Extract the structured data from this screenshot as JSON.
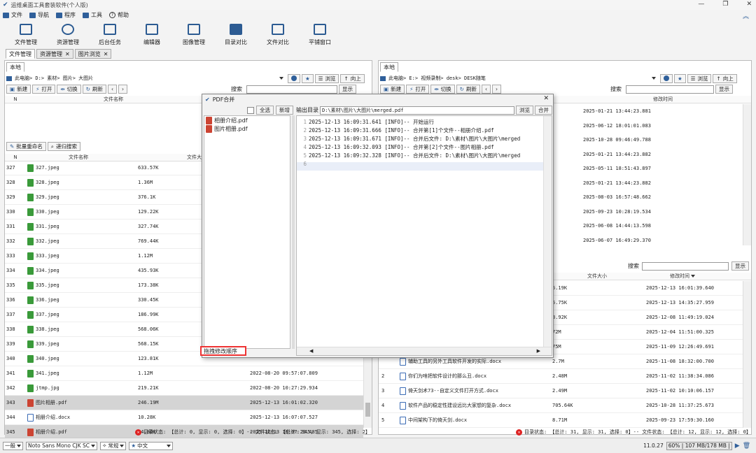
{
  "app": {
    "title": "运维桌面工具套装软件(个人版)"
  },
  "menu": [
    "文件",
    "导航",
    "程序",
    "工具",
    "帮助"
  ],
  "toolbar": [
    "文件管理",
    "资源管理",
    "后台任务",
    "编辑器",
    "图像管理",
    "目录对比",
    "文件对比",
    "平铺窗口"
  ],
  "tabs": [
    "文件管理",
    "资源管理",
    "图片浏览"
  ],
  "left": {
    "local_tab": "本地",
    "path": "此电脑> D:> 素材> 图片> 大图片",
    "browse": "浏览",
    "up": "向上",
    "search_label": "搜索",
    "show": "显示",
    "buttons": [
      "新建",
      "打开",
      "切换",
      "刷新"
    ],
    "col_n": "N",
    "col_name": "文件名称",
    "batch_rename": "批量重命名",
    "recursive_search": "递归搜索",
    "col_n2": "N",
    "col_name2": "文件名称",
    "col_size2": "文件大",
    "rows": [
      {
        "n": "327",
        "name": "327.jpeg",
        "size": "633.57K",
        "time": "",
        "type": "img"
      },
      {
        "n": "328",
        "name": "328.jpeg",
        "size": "1.36M",
        "time": "",
        "type": "img"
      },
      {
        "n": "329",
        "name": "329.jpeg",
        "size": "376.1K",
        "time": "",
        "type": "img"
      },
      {
        "n": "330",
        "name": "330.jpeg",
        "size": "129.22K",
        "time": "",
        "type": "img"
      },
      {
        "n": "331",
        "name": "331.jpeg",
        "size": "327.74K",
        "time": "",
        "type": "img"
      },
      {
        "n": "332",
        "name": "332.jpeg",
        "size": "769.44K",
        "time": "",
        "type": "img"
      },
      {
        "n": "333",
        "name": "333.jpeg",
        "size": "1.12M",
        "time": "",
        "type": "img"
      },
      {
        "n": "334",
        "name": "334.jpeg",
        "size": "435.93K",
        "time": "",
        "type": "img"
      },
      {
        "n": "335",
        "name": "335.jpeg",
        "size": "173.38K",
        "time": "",
        "type": "img"
      },
      {
        "n": "336",
        "name": "336.jpeg",
        "size": "330.45K",
        "time": "",
        "type": "img"
      },
      {
        "n": "337",
        "name": "337.jpeg",
        "size": "186.99K",
        "time": "",
        "type": "img"
      },
      {
        "n": "338",
        "name": "338.jpeg",
        "size": "568.06K",
        "time": "",
        "type": "img"
      },
      {
        "n": "339",
        "name": "339.jpeg",
        "size": "568.15K",
        "time": "",
        "type": "img"
      },
      {
        "n": "340",
        "name": "340.jpeg",
        "size": "123.81K",
        "time": "",
        "type": "img"
      },
      {
        "n": "341",
        "name": "341.jpeg",
        "size": "1.12M",
        "time": "2022-08-20 09:57:07.809",
        "type": "img"
      },
      {
        "n": "342",
        "name": "jtmp.jpg",
        "size": "219.21K",
        "time": "2022-08-20 10:27:29.934",
        "type": "img"
      },
      {
        "n": "343",
        "name": "图片相册.pdf",
        "size": "246.19M",
        "time": "2025-12-13 16:01:02.320",
        "type": "pdf"
      },
      {
        "n": "344",
        "name": "相册介绍.docx",
        "size": "10.28K",
        "time": "2025-12-13 16:07:07.527",
        "type": "doc"
      },
      {
        "n": "345",
        "name": "相册介绍.pdf",
        "size": "84.86K",
        "time": "2025-12-13 16:07:23.485",
        "type": "pdf"
      }
    ],
    "status": "目录状态: 【总计: 0, 显示: 0, 选择: 0】-- 文件状态: 【总计: 345, 显示: 345, 选择: 2】"
  },
  "right": {
    "local_tab": "本地",
    "path": "此电脑> E:> 视频录制> desk> DESK随笔",
    "browse": "浏览",
    "up": "向上",
    "search_label": "搜索",
    "show": "显示",
    "buttons": [
      "新建",
      "打开",
      "切换",
      "刷新"
    ],
    "col_mtime": "修改时间",
    "top_times": [
      "2025-01-21 13:44:23.881",
      "2025-06-12 18:01:01.083",
      "2025-10-28 09:46:49.788",
      "2025-01-21 13:44:23.882",
      "2025-05-11 18:51:43.897",
      "2025-01-21 13:44:23.882",
      "2025-08-03 16:57:48.662",
      "2025-09-23 10:28:19.534",
      "2025-06-08 14:44:13.598",
      "2025-06-07 16:49:29.370"
    ],
    "search_label2": "搜索",
    "show2": "显示",
    "col_size": "文件大小",
    "col_mtime2": "修改时间",
    "bottom_rows": [
      {
        "n": "",
        "name": "",
        "size": "5.19K",
        "time": "2025-12-13 16:01:39.640"
      },
      {
        "n": "",
        "name": "",
        "size": "5.75K",
        "time": "2025-12-13 14:35:27.959"
      },
      {
        "n": "",
        "name": "",
        "size": "3.92K",
        "time": "2025-12-08 11:49:19.024"
      },
      {
        "n": "",
        "name": "",
        "size": "72M",
        "time": "2025-12-04 11:51:00.325"
      },
      {
        "n": "",
        "name": "",
        "size": "75M",
        "time": "2025-11-09 12:26:49.691"
      },
      {
        "n": "",
        "name": "辅助工具的另外工具软件开发的实际.docx",
        "size": "2.7M",
        "time": "2025-11-08 18:32:00.700"
      },
      {
        "n": "2",
        "name": "你们为啥把软件设计的那么丑.docx",
        "size": "2.48M",
        "time": "2025-11-02 11:38:34.086"
      },
      {
        "n": "3",
        "name": "倚天剑术73--自定义文件打开方式.docx",
        "size": "2.49M",
        "time": "2025-11-02 10:10:06.157"
      },
      {
        "n": "4",
        "name": "软件产品的稳定性建设远比大家想的复杂.docx",
        "size": "705.64K",
        "time": "2025-10-28 11:37:25.673"
      },
      {
        "n": "5",
        "name": "中间架构下的倚天剑.docx",
        "size": "8.71M",
        "time": "2025-09-23 17:59:30.160"
      }
    ],
    "status": "目录状态: 【总计: 31, 显示: 31, 选择: 0】-- 文件状态: 【总计: 12, 显示: 12, 选择: 0】"
  },
  "dialog": {
    "title": "PDF合并",
    "select_all": "全选",
    "new": "新增",
    "files": [
      "相册介绍.pdf",
      "图片相册.pdf"
    ],
    "output_label": "输出目录",
    "output_path": "D:\\素材\\图片\\大图片\\merged.pdf",
    "browse": "浏览",
    "merge": "合并",
    "drag_hint": "拖拽修改顺序",
    "log": [
      "2025-12-13 16:09:31.641 [INFO]-- 开始运行",
      "2025-12-13 16:09:31.666 [INFO]-- 合并第[1]个文件--相册介绍.pdf",
      "2025-12-13 16:09:31.671 [INFO]-- 合并后文件: D:\\素材\\图片\\大图片\\merged",
      "2025-12-13 16:09:32.093 [INFO]-- 合并第[2]个文件--图片相册.pdf",
      "2025-12-13 16:09:32.328 [INFO]-- 合并后文件: D:\\素材\\图片\\大图片\\merged"
    ],
    "line_numbers": [
      "1",
      "2",
      "3",
      "4",
      "5",
      "6"
    ]
  },
  "bottom": {
    "combo1": "一般",
    "font": "Noto Sans Mono CJK SC",
    "style": "常规",
    "lang": "中文",
    "version": "11.0.27",
    "memory": "60% | 107 MB/178 MB |"
  }
}
